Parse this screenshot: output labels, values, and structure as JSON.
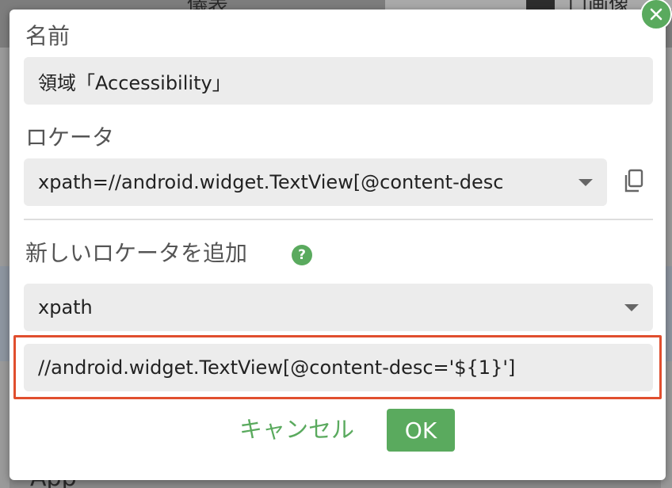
{
  "background": {
    "header_text_left": "儀表",
    "header_text_right": "口画像",
    "bottom_text": "App"
  },
  "dialog": {
    "name_label": "名前",
    "name_value": "領域「Accessibility」",
    "locator_label": "ロケータ",
    "locator_value": "xpath=//android.widget.TextView[@content-desc",
    "add_locator_label": "新しいロケータを追加",
    "help_glyph": "?",
    "strategy_value": "xpath",
    "new_locator_value": "//android.widget.TextView[@content-desc='${1}']",
    "cancel_label": "キャンセル",
    "ok_label": "OK"
  },
  "colors": {
    "accent": "#5aaa5e",
    "highlight": "#e04e2e",
    "field_bg": "#ececec"
  },
  "icons": {
    "close": "close-icon",
    "copy": "copy-icon",
    "help": "help-icon",
    "dropdown": "chevron-down-icon"
  }
}
